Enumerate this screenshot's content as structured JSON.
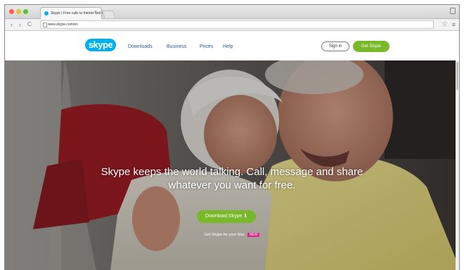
{
  "browser": {
    "tab_title": "Skype | Free calls to friends and fa...",
    "tab_close": "×",
    "url": "www.skype.com/en",
    "back_icon": "‹",
    "forward_icon": "›",
    "reload_icon": "C",
    "star_icon": "☆",
    "menu_icon": "≡"
  },
  "site": {
    "logo": "skype",
    "nav": [
      "Downloads",
      "Business",
      "Prices",
      "Help"
    ],
    "signin_label": "Sign in",
    "get_skype_label": "Get Skype"
  },
  "hero": {
    "headline_line1": "Skype keeps the world talking. Call, message and share",
    "headline_line2": "whatever you want for free.",
    "download_label": "Download Skype ⬇",
    "fine_print": "Get Skype for your Mac",
    "fine_print_badge": "NEW"
  },
  "colors": {
    "brand_blue": "#00aff0",
    "accent_green": "#78b829",
    "badge_pink": "#e0218a"
  }
}
